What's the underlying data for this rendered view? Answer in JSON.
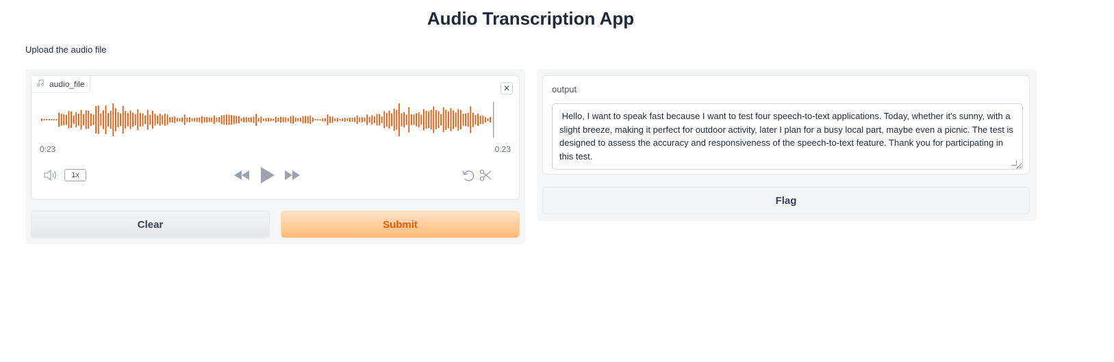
{
  "page": {
    "title": "Audio Transcription App",
    "description": "Upload the audio file"
  },
  "audio": {
    "label": "audio_file",
    "close_icon": "close-icon",
    "time_current": "0:23",
    "time_total": "0:23",
    "speed": "1x",
    "wave_color": "#ea580c",
    "icons": {
      "volume": "volume-icon",
      "rewind": "rewind-icon",
      "play": "play-icon",
      "forward": "fast-forward-icon",
      "undo": "undo-icon",
      "trim": "scissors-icon"
    }
  },
  "buttons": {
    "clear": "Clear",
    "submit": "Submit",
    "flag": "Flag"
  },
  "output": {
    "label": "output",
    "value": " Hello, I want to speak fast because I want to test four speech-to-text applications. Today, whether it's sunny, with a slight breeze, making it perfect for outdoor activity, later I plan for a busy local part, maybe even a picnic. The test is designed to assess the accuracy and responsiveness of the speech-to-text feature. Thank you for participating in this test."
  }
}
